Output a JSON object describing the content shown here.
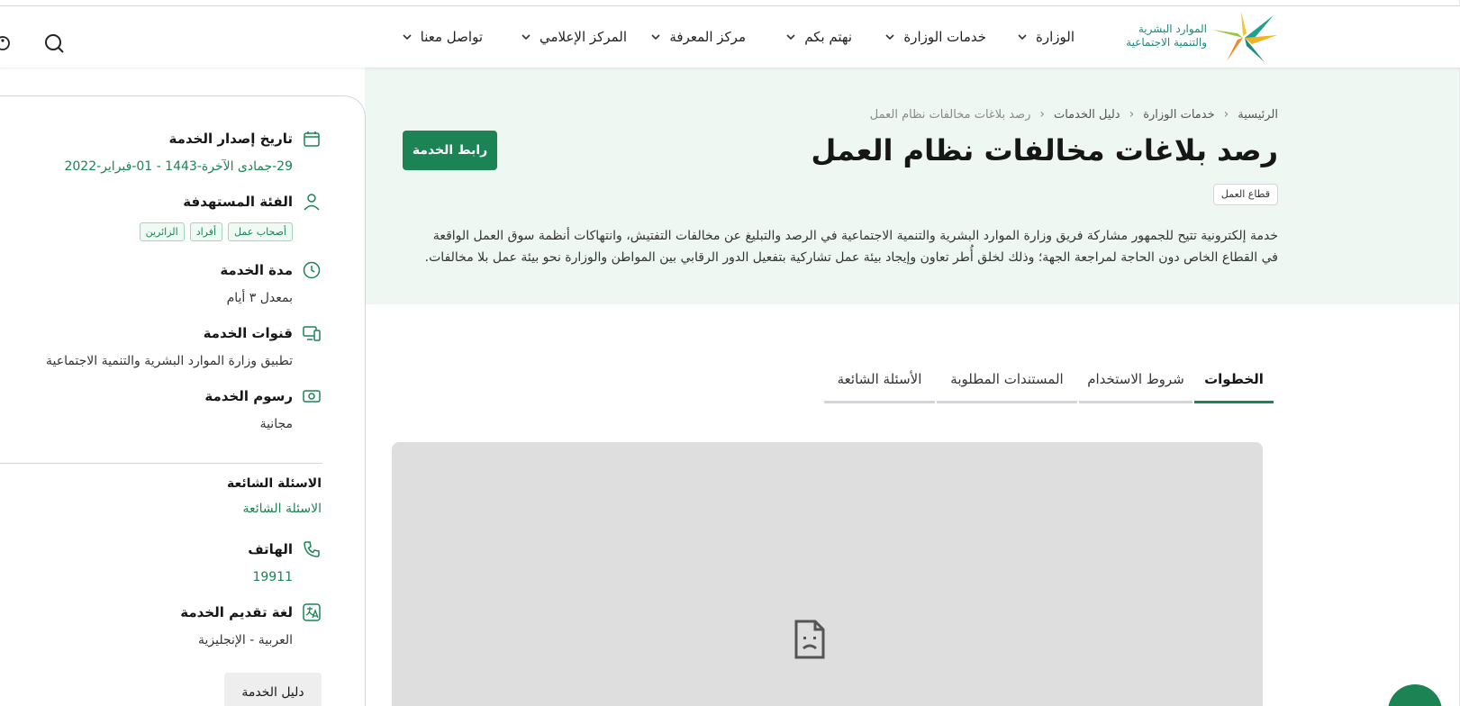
{
  "header": {
    "logo_line1": "الموارد البشرية",
    "logo_line2": "والتنمية الاجتماعية",
    "nav": [
      {
        "label": "الوزارة"
      },
      {
        "label": "خدمات الوزارة"
      },
      {
        "label": "نهتم بكم"
      },
      {
        "label": "مركز المعرفة"
      },
      {
        "label": "المركز الإعلامي"
      },
      {
        "label": "تواصل معنا"
      }
    ],
    "icons": {
      "search": "search-icon",
      "accessibility": "accessibility-icon"
    }
  },
  "hero": {
    "breadcrumb": [
      "الرئيسية",
      "خدمات الوزارة",
      "دليل الخدمات",
      "رصد بلاغات مخالفات نظام العمل"
    ],
    "title": "رصد بلاغات مخالفات نظام العمل",
    "service_link_label": "رابط الخدمة",
    "sector_tag": "قطاع العمل",
    "description": "خدمة إلكترونية تتيح للجمهور مشاركة فريق وزارة الموارد البشرية والتنمية الاجتماعية في الرصد والتبليغ عن مخالفات التفتيش، وانتهاكات أنظمة سوق العمل الواقعة في القطاع الخاص دون الحاجة لمراجعة الجهة؛ وذلك لخلق أُطر تعاون وإيجاد بيئة عمل تشاركية بتفعيل الدور الرقابي بين المواطن والوزارة نحو بيئة عمل بلا مخالفات."
  },
  "tabs": [
    {
      "label": "الخطوات",
      "active": true
    },
    {
      "label": "شروط الاستخدام",
      "active": false
    },
    {
      "label": "المستندات المطلوبة",
      "active": false
    },
    {
      "label": "الأسئلة الشائعة",
      "active": false
    }
  ],
  "sidebar": {
    "release_date": {
      "title": "تاريخ إصدار الخدمة",
      "value": "29-جمادى الآخرة-1443 - 01-فبراير-2022"
    },
    "target_group": {
      "title": "الفئة المستهدفة",
      "tags": [
        "أصحاب عمل",
        "أفراد",
        "الزائرين"
      ]
    },
    "duration": {
      "title": "مدة الخدمة",
      "value": "بمعدل ٣ أيام"
    },
    "channels": {
      "title": "قنوات الخدمة",
      "value": "تطبيق وزارة الموارد البشرية والتنمية الاجتماعية"
    },
    "fees": {
      "title": "رسوم الخدمة",
      "value": "مجانية"
    },
    "faq": {
      "title": "الاسئلة الشائعة",
      "value": "الاسئلة الشائعة"
    },
    "phone": {
      "title": "الهاتف",
      "value": "19911"
    },
    "language": {
      "title": "لغة تقديم الخدمة",
      "value": "العربية - الإنجليزية"
    },
    "guide_button": "دليل الخدمة"
  },
  "colors": {
    "brand_green": "#1b8354",
    "hero_bg": "#eef7f2",
    "frame_bg": "#dedede"
  }
}
